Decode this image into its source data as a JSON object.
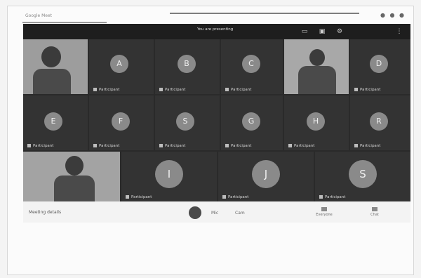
{
  "browser": {
    "tab_title": "Google Meet",
    "window_controls": "● ● ●"
  },
  "meet": {
    "presenting_text": "You are presenting",
    "top_controls": [
      "▭",
      "▣",
      "⚙",
      "⋮"
    ],
    "participants": [
      {
        "name": "Participant",
        "type": "video"
      },
      {
        "name": "Participant",
        "type": "avatar",
        "initial": "A"
      },
      {
        "name": "Participant",
        "type": "avatar",
        "initial": "B"
      },
      {
        "name": "Participant",
        "type": "avatar",
        "initial": "C"
      },
      {
        "name": "Participant",
        "type": "video"
      },
      {
        "name": "Participant",
        "type": "avatar",
        "initial": "D"
      },
      {
        "name": "Participant",
        "type": "avatar",
        "initial": "E"
      },
      {
        "name": "Participant",
        "type": "avatar",
        "initial": "F"
      },
      {
        "name": "Participant",
        "type": "avatar",
        "initial": "S"
      },
      {
        "name": "Participant",
        "type": "avatar",
        "initial": "G"
      },
      {
        "name": "Participant",
        "type": "avatar",
        "initial": "H"
      },
      {
        "name": "Participant",
        "type": "avatar",
        "initial": "R"
      },
      {
        "name": "Participant",
        "type": "video"
      },
      {
        "name": "Participant",
        "type": "avatar",
        "initial": "I"
      },
      {
        "name": "Participant",
        "type": "avatar",
        "initial": "J"
      },
      {
        "name": "Participant",
        "type": "avatar",
        "initial": "S"
      }
    ]
  },
  "bottombar": {
    "meeting_code": "Meeting details",
    "mic_label": "Mic",
    "cam_label": "Cam",
    "tools": [
      "Everyone",
      "Chat"
    ]
  }
}
